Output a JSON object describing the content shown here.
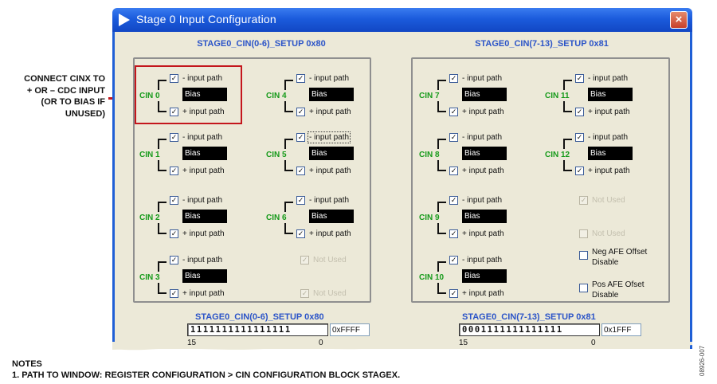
{
  "callout": {
    "lines": [
      "CONNECT CINX TO",
      "+ OR – CDC INPUT",
      "(OR TO BIAS IF",
      "UNUSED)"
    ]
  },
  "window": {
    "title": "Stage 0 Input Configuration",
    "close_label": "×"
  },
  "left_group": {
    "title": "STAGE0_CIN(0-6)_SETUP 0x80",
    "blocks": [
      {
        "cin": "CIN 0",
        "neg_label": "- input path",
        "bias": "Bias",
        "pos_label": "+ input path",
        "neg_checked": true,
        "pos_checked": true
      },
      {
        "cin": "CIN 1",
        "neg_label": "- input path",
        "bias": "Bias",
        "pos_label": "+ input path",
        "neg_checked": true,
        "pos_checked": true
      },
      {
        "cin": "CIN 2",
        "neg_label": "- input path",
        "bias": "Bias",
        "pos_label": "+ input path",
        "neg_checked": true,
        "pos_checked": true
      },
      {
        "cin": "CIN 3",
        "neg_label": "- input path",
        "bias": "Bias",
        "pos_label": "+ input path",
        "neg_checked": true,
        "pos_checked": true
      },
      {
        "cin": "CIN 4",
        "neg_label": "- input path",
        "bias": "Bias",
        "pos_label": "+ input path",
        "neg_checked": true,
        "pos_checked": true
      },
      {
        "cin": "CIN 5",
        "neg_label": "- input path",
        "bias": "Bias",
        "pos_label": "+ input path",
        "neg_checked": true,
        "pos_checked": true
      },
      {
        "cin": "CIN 6",
        "neg_label": "- input path",
        "bias": "Bias",
        "pos_label": "+ input path",
        "neg_checked": true,
        "pos_checked": true
      }
    ],
    "not_used": [
      "Not Used",
      "Not Used"
    ]
  },
  "right_group": {
    "title": "STAGE0_CIN(7-13)_SETUP 0x81",
    "blocks": [
      {
        "cin": "CIN 7",
        "neg_label": "- input path",
        "bias": "Bias",
        "pos_label": "+ input path",
        "neg_checked": true,
        "pos_checked": true
      },
      {
        "cin": "CIN 8",
        "neg_label": "- input path",
        "bias": "Bias",
        "pos_label": "+ input path",
        "neg_checked": true,
        "pos_checked": true
      },
      {
        "cin": "CIN 9",
        "neg_label": "- input path",
        "bias": "Bias",
        "pos_label": "+ input path",
        "neg_checked": true,
        "pos_checked": true
      },
      {
        "cin": "CIN 10",
        "neg_label": "- input path",
        "bias": "Bias",
        "pos_label": "+ input path",
        "neg_checked": true,
        "pos_checked": true
      },
      {
        "cin": "CIN 11",
        "neg_label": "- input path",
        "bias": "Bias",
        "pos_label": "+ input path",
        "neg_checked": true,
        "pos_checked": true
      },
      {
        "cin": "CIN 12",
        "neg_label": "- input path",
        "bias": "Bias",
        "pos_label": "+ input path",
        "neg_checked": true,
        "pos_checked": true
      }
    ],
    "not_used": [
      "Not Used",
      "Not Used"
    ],
    "neg_afe": {
      "line1": "Neg AFE Offset",
      "line2": "Disable",
      "checked": false
    },
    "pos_afe": {
      "line1": "Pos AFE Ofset",
      "line2": "Disable",
      "checked": false
    }
  },
  "register_left": {
    "title": "STAGE0_CIN(0-6)_SETUP 0x80",
    "bits": "1111111111111111",
    "hex": "0xFFFF",
    "msb": "15",
    "lsb": "0"
  },
  "register_right": {
    "title": "STAGE0_CIN(7-13)_SETUP 0x81",
    "bits": "0001111111111111",
    "hex": "0x1FFF",
    "msb": "15",
    "lsb": "0"
  },
  "notes": {
    "heading": "NOTES",
    "line1": "1. PATH TO WINDOW: REGISTER CONFIGURATION > CIN CONFIGURATION BLOCK STAGEX."
  },
  "figure_id": "08926-007",
  "check_glyph": "✓",
  "colors": {
    "title_bar": "#1b5bdc",
    "cin_label": "#169a1a",
    "section_title": "#2b54c8",
    "highlight": "#c4161c",
    "client_bg": "#ece9d8"
  },
  "icons": {
    "title": "play-arrow-icon",
    "close": "close-icon"
  }
}
